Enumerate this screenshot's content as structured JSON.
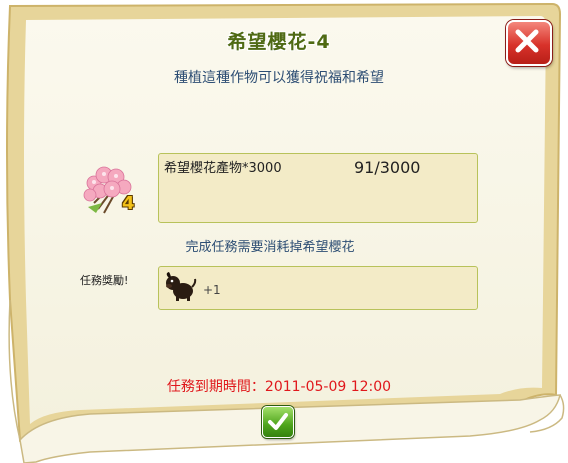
{
  "dialog": {
    "title": "希望櫻花-4",
    "subtitle": "種植這種作物可以獲得祝福和希望",
    "close_icon": "close-icon",
    "confirm_icon": "checkmark-icon"
  },
  "requirement": {
    "item_icon": "cherry-blossom-icon",
    "item_count": "4",
    "label": "希望櫻花產物*3000",
    "progress_text": "91/3000",
    "progress_current": 91,
    "progress_total": 3000
  },
  "consume_note": "完成任務需要消耗掉希望櫻花",
  "reward": {
    "label": "任務獎勵!",
    "icon": "dog-icon",
    "amount": "+1"
  },
  "expire_text": "任務到期時間：2011-05-09 12:00",
  "colors": {
    "title": "#4f6a14",
    "subtitle": "#2d4e74",
    "expire": "#e0181c",
    "panel": "#f3ebc7",
    "panel_border": "#b8c25a"
  }
}
